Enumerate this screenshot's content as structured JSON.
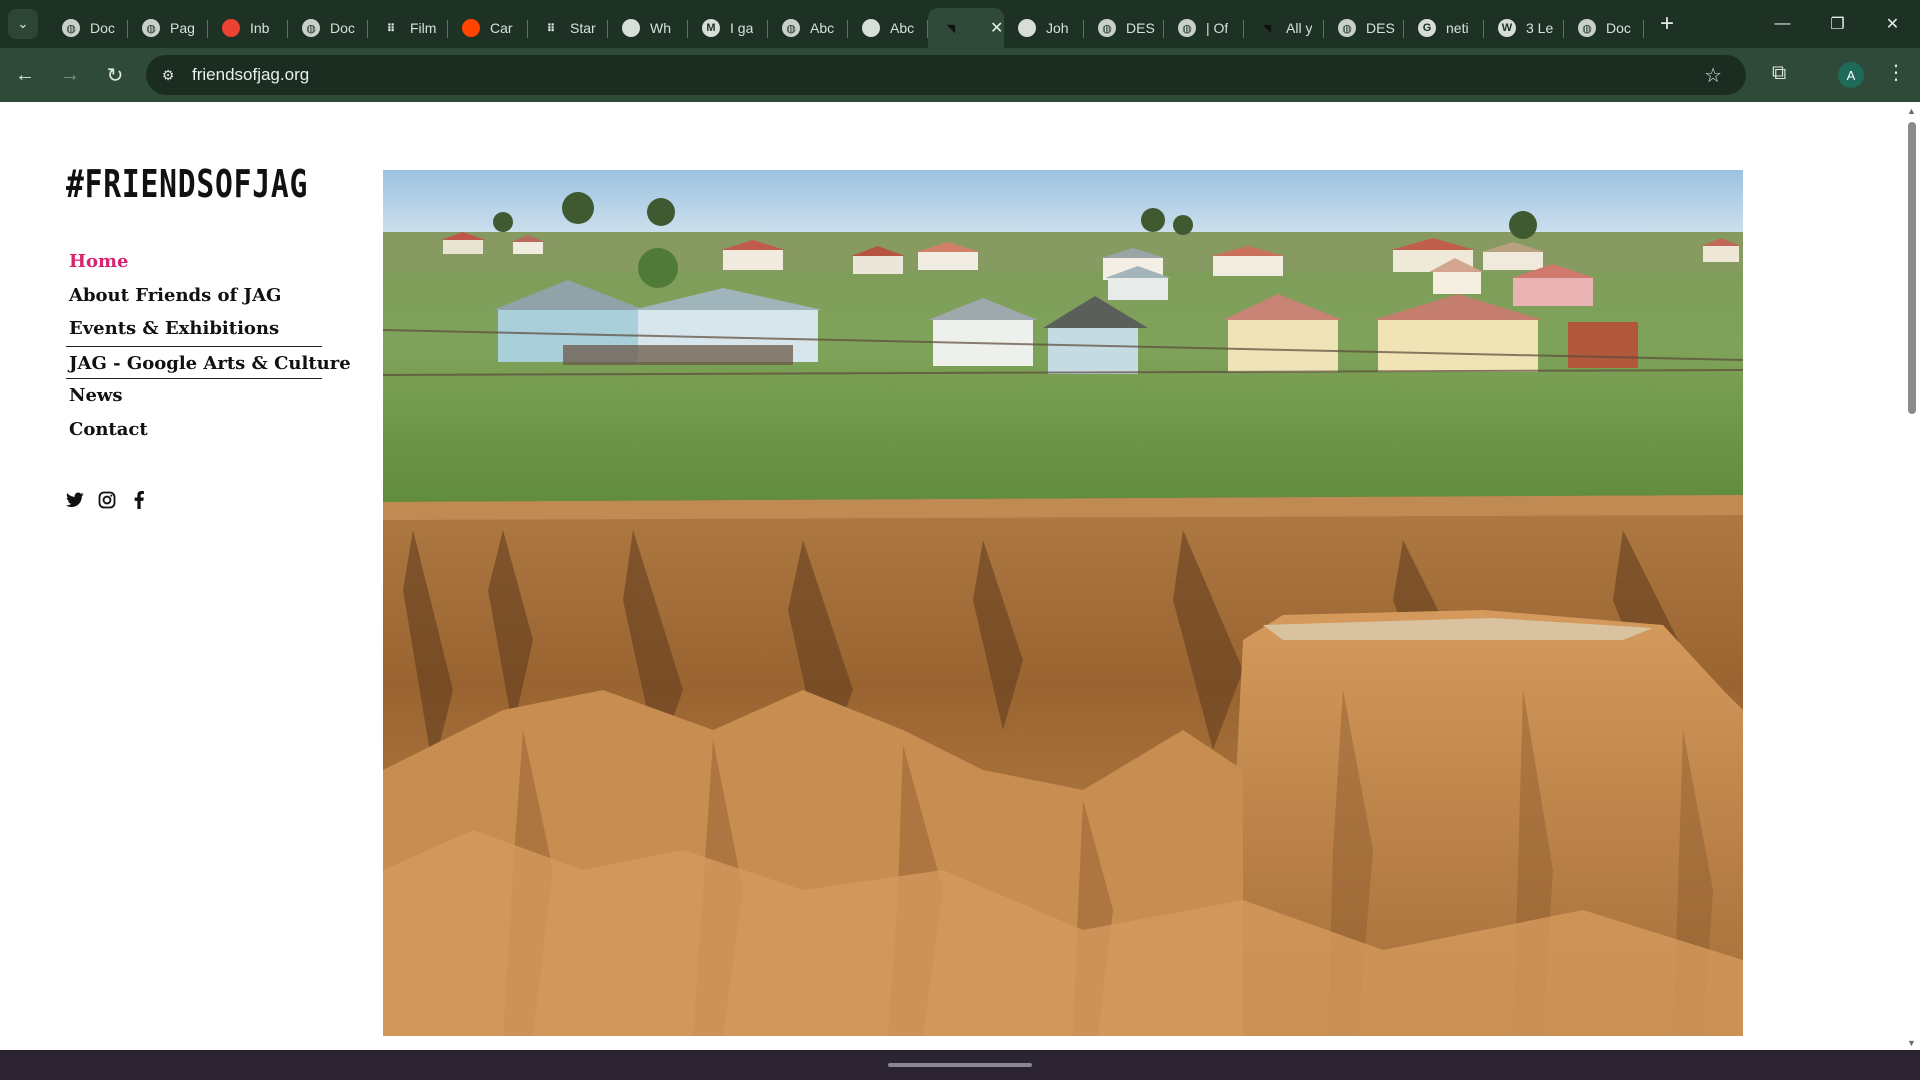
{
  "browser": {
    "tabs": [
      {
        "title": "Doc",
        "icon": "globe-icon"
      },
      {
        "title": "Pag",
        "icon": "globe-icon"
      },
      {
        "title": "Inb",
        "icon": "gmail-icon"
      },
      {
        "title": "Doc",
        "icon": "globe-icon"
      },
      {
        "title": "Film",
        "icon": "apps-grid-icon"
      },
      {
        "title": "Car",
        "icon": "reddit-icon"
      },
      {
        "title": "Star",
        "icon": "apps-grid-icon"
      },
      {
        "title": "Wh",
        "icon": "site-icon"
      },
      {
        "title": "I ga",
        "icon": "medium-icon",
        "badge": "M"
      },
      {
        "title": "Abc",
        "icon": "globe-icon"
      },
      {
        "title": "Abc",
        "icon": "site-icon"
      },
      {
        "title": "",
        "icon": "jag-icon",
        "active": true
      },
      {
        "title": "Joh",
        "icon": "site-icon"
      },
      {
        "title": "DES",
        "icon": "globe-icon"
      },
      {
        "title": "| Of",
        "icon": "globe-icon"
      },
      {
        "title": "All y",
        "icon": "jag-icon"
      },
      {
        "title": "DES",
        "icon": "globe-icon"
      },
      {
        "title": "neti",
        "icon": "google-icon",
        "badge": "G"
      },
      {
        "title": "3 Le",
        "icon": "w-icon",
        "badge": "W"
      },
      {
        "title": "Doc",
        "icon": "globe-icon"
      }
    ],
    "url": "friendsofjag.org",
    "profile_initial": "A"
  },
  "site": {
    "logo": "#FRIENDSOFJAG",
    "nav": [
      {
        "label": "Home",
        "current": true
      },
      {
        "label": "About Friends of JAG"
      },
      {
        "label": "Events & Exhibitions"
      },
      {
        "label": "JAG - Google Arts & Culture"
      },
      {
        "label": "News"
      },
      {
        "label": "Contact"
      }
    ],
    "social": [
      {
        "icon": "twitter-icon"
      },
      {
        "icon": "instagram-icon"
      },
      {
        "icon": "facebook-icon"
      }
    ],
    "hero_image": "rural village houses above an eroded sandstone gully"
  },
  "colors": {
    "accent": "#d6246e",
    "chrome_dark": "#1d3224",
    "chrome_toolbar": "#2f4a38",
    "text": "#111111"
  }
}
